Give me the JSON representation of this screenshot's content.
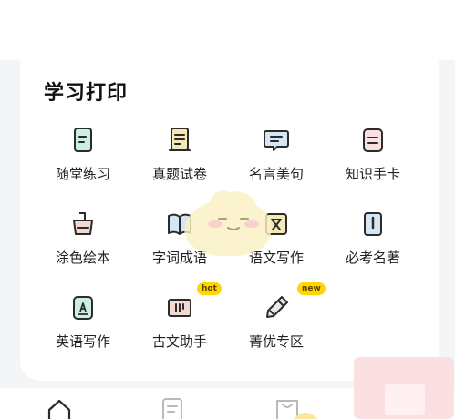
{
  "section": {
    "title": "学习打印"
  },
  "items": [
    {
      "label": "随堂练习",
      "icon": "document-icon"
    },
    {
      "label": "真题试卷",
      "icon": "scroll-icon"
    },
    {
      "label": "名言美句",
      "icon": "chat-icon"
    },
    {
      "label": "知识手卡",
      "icon": "card-icon"
    },
    {
      "label": "涂色绘本",
      "icon": "paint-bucket-icon"
    },
    {
      "label": "字词成语",
      "icon": "book-icon"
    },
    {
      "label": "语文写作",
      "icon": "wen-icon"
    },
    {
      "label": "必考名著",
      "icon": "classic-book-icon"
    },
    {
      "label": "英语写作",
      "icon": "english-icon"
    },
    {
      "label": "古文助手",
      "icon": "ancient-text-icon",
      "badge": "hot"
    },
    {
      "label": "菁优专区",
      "icon": "pen-icon",
      "badge": "new"
    }
  ],
  "nav": {
    "items": [
      "home-icon",
      "notes-icon",
      "bag-icon"
    ]
  },
  "colors": {
    "accent_yellow": "#ffd600",
    "mint": "#cdeee3",
    "peach": "#f3d9cf",
    "blue": "#d5e6f7",
    "pink": "#fbe0e2"
  }
}
